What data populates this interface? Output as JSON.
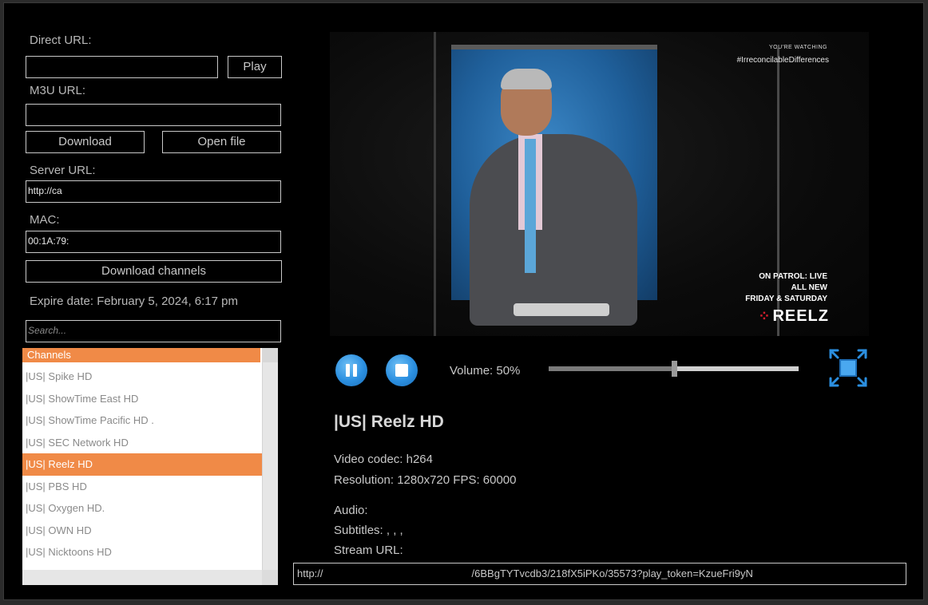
{
  "left": {
    "direct_url_label": "Direct URL:",
    "direct_url_value": "",
    "play_label": "Play",
    "m3u_url_label": "M3U URL:",
    "m3u_url_value": "",
    "download_label": "Download",
    "open_file_label": "Open file",
    "server_url_label": "Server URL:",
    "server_url_value": "http://ca",
    "mac_label": "MAC:",
    "mac_value": "00:1A:79:",
    "download_channels_label": "Download channels",
    "expire_text": "Expire date: February 5, 2024, 6:17 pm",
    "search_placeholder": "Search..."
  },
  "channels": {
    "header": "Channels",
    "items": [
      "|US| Spike HD",
      "|US| ShowTime East HD",
      "|US| ShowTime Pacific HD .",
      "|US| SEC Network HD",
      "|US| Reelz HD",
      "|US| PBS HD",
      "|US| Oxygen HD.",
      "|US| OWN HD",
      "|US| Nicktoons HD"
    ],
    "selected": "|US| Reelz HD"
  },
  "video": {
    "watching_label": "YOU'RE WATCHING",
    "hashtag": "#IrreconcilableDifferences",
    "promo_line1": "ON PATROL: LIVE",
    "promo_line2": "ALL NEW",
    "promo_line3": "FRIDAY & SATURDAY",
    "logo_text": "REELZ"
  },
  "controls": {
    "volume_label": "Volume: 50%",
    "volume_level": 0.5
  },
  "info": {
    "channel_title": "|US| Reelz HD",
    "video_codec": "Video codec: h264",
    "resolution": "Resolution: 1280x720 FPS: 60000",
    "audio": "Audio:",
    "subtitles": "Subtitles: , , ,",
    "stream_url_label": "Stream URL:",
    "stream_url_start": "http://",
    "stream_url_end": "/6BBgTYTvcdb3/218fX5iPKo/35573?play_token=KzueFri9yN"
  },
  "colors": {
    "accent": "#f08a47",
    "control_blue": "#2b8fe0"
  }
}
